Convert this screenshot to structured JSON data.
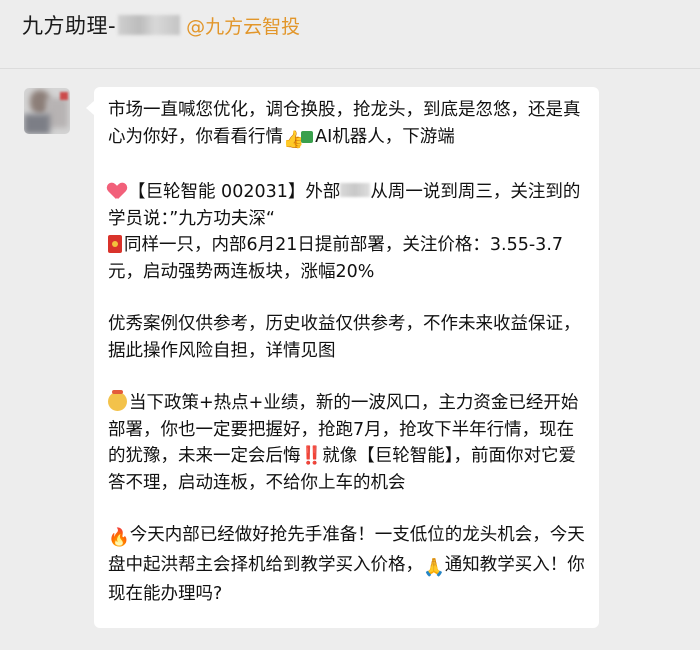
{
  "header": {
    "title": "九方助理-",
    "corp": "@九方云智投"
  },
  "message": {
    "p1": "市场一直喊您优化，调仓换股，抢龙头，到底是忽悠，还是真心为你好，你看看行情",
    "p1_tail": "AI机器人，下游端",
    "p2a_pre": "【巨轮智能 002031】外部",
    "p2a_post": "从周一说到周三，关注到的学员说：”九方功夫深“",
    "p2b": "同样一只，内部6月21日提前部署，关注价格：3.55-3.7元，启动强势两连板块，涨幅20%",
    "p3": "优秀案例仅供参考，历史收益仅供参考，不作未来收益保证，据此操作风险自担，详情见图",
    "p4": "当下政策+热点+业绩，新的一波风口，主力资金已经开始部署，你也一定要把握好，抢跑7月，抢攻下半年行情，现在的犹豫，未来一定会后悔‼️就像【巨轮智能】，前面你对它爱答不理，启动连板，不给你上车的机会",
    "p5": "今天内部已经做好抢先手准备！一支低位的龙头机会，今天盘中起洪帮主会择机给到教学买入价格，",
    "p5_tail": "通知教学买入！你现在能办理吗?"
  },
  "icons": {
    "heart": "heart-icon",
    "thumbs_up": "thumbs-up-icon",
    "red_envelope": "red-envelope-icon",
    "saluting_face": "saluting-face-icon",
    "fire": "fire-icon",
    "pray": "pray-icon"
  }
}
